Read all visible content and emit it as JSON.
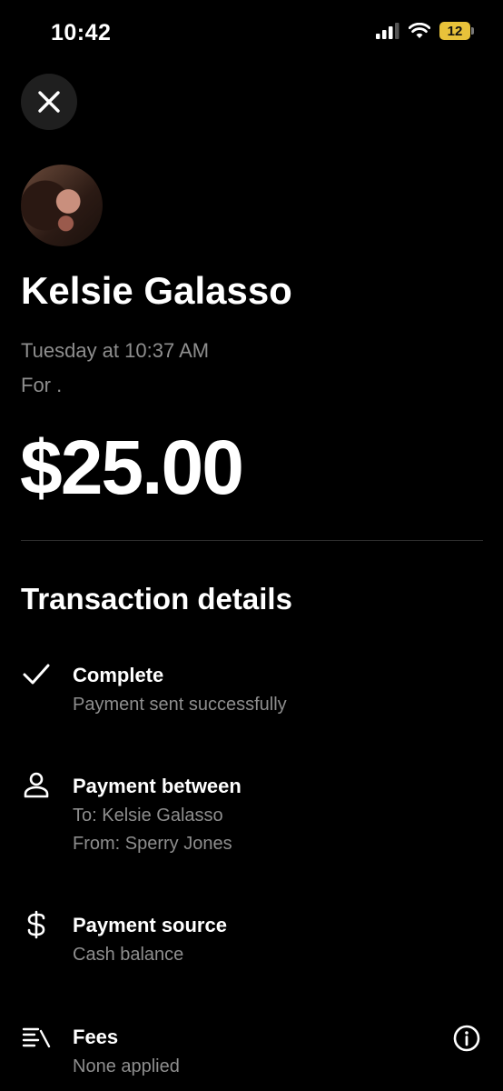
{
  "status_bar": {
    "time": "10:42",
    "battery": "12",
    "icons": [
      "signal-icon",
      "wifi-icon",
      "battery-icon"
    ]
  },
  "header": {
    "close_icon": "close-icon"
  },
  "recipient": {
    "name": "Kelsie Galasso",
    "datetime": "Tuesday at 10:37 AM",
    "note": "For ."
  },
  "amount": "$25.00",
  "details": {
    "title": "Transaction details",
    "items": [
      {
        "icon": "check-icon",
        "title": "Complete",
        "lines": [
          "Payment sent successfully"
        ]
      },
      {
        "icon": "person-icon",
        "title": "Payment between",
        "lines": [
          "To: Kelsie Galasso",
          "From: Sperry Jones"
        ]
      },
      {
        "icon": "dollar-icon",
        "title": "Payment source",
        "lines": [
          "Cash balance"
        ]
      },
      {
        "icon": "fees-icon",
        "title": "Fees",
        "lines": [
          "None applied"
        ],
        "action_icon": "info-icon"
      }
    ]
  },
  "colors": {
    "background": "#000000",
    "text": "#ffffff",
    "secondary_text": "#8e8e8e",
    "battery": "#e8c23a"
  }
}
